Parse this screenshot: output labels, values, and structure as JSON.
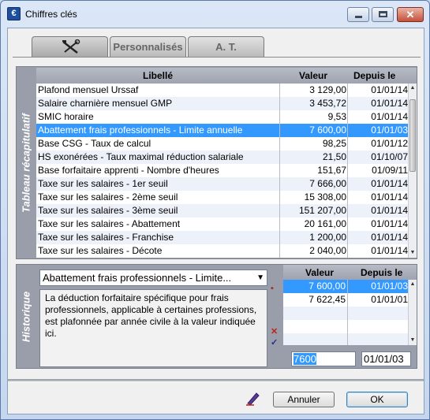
{
  "window": {
    "title": "Chiffres clés",
    "icon_letter": "€",
    "controls": {
      "minimize": "minimize-icon",
      "maximize": "maximize-icon",
      "close": "close-icon"
    }
  },
  "tabs": [
    {
      "label": "",
      "icon": "tools-icon",
      "active": true
    },
    {
      "label": "Personnalisés",
      "active": false
    },
    {
      "label": "A. T.",
      "active": false
    }
  ],
  "summary": {
    "side_label": "Tableau récapitulatif",
    "columns": {
      "label": "Libellé",
      "value": "Valeur",
      "since": "Depuis le"
    },
    "rows": [
      {
        "label": "Plafond mensuel Urssaf",
        "value": "3 129,00",
        "since": "01/01/14"
      },
      {
        "label": "Salaire charnière mensuel GMP",
        "value": "3 453,72",
        "since": "01/01/14"
      },
      {
        "label": "SMIC horaire",
        "value": "9,53",
        "since": "01/01/14"
      },
      {
        "label": "Abattement frais professionnels - Limite annuelle",
        "value": "7 600,00",
        "since": "01/01/03",
        "selected": true
      },
      {
        "label": "Base CSG - Taux de calcul",
        "value": "98,25",
        "since": "01/01/12"
      },
      {
        "label": "HS exonérées - Taux maximal réduction salariale",
        "value": "21,50",
        "since": "01/10/07"
      },
      {
        "label": "Base forfaitaire apprenti - Nombre d'heures",
        "value": "151,67",
        "since": "01/09/11"
      },
      {
        "label": "Taxe sur les salaires - 1er seuil",
        "value": "7 666,00",
        "since": "01/01/14"
      },
      {
        "label": "Taxe sur les salaires - 2ème seuil",
        "value": "15 308,00",
        "since": "01/01/14"
      },
      {
        "label": "Taxe sur les salaires - 3ème seuil",
        "value": "151 207,00",
        "since": "01/01/14"
      },
      {
        "label": "Taxe sur les salaires - Abattement",
        "value": "20 161,00",
        "since": "01/01/14"
      },
      {
        "label": "Taxe sur les salaires - Franchise",
        "value": "1 200,00",
        "since": "01/01/14"
      },
      {
        "label": "Taxe sur les salaires - Décote",
        "value": "2 040,00",
        "since": "01/01/14"
      }
    ]
  },
  "history": {
    "side_label": "Historique",
    "selected_item": "Abattement frais professionnels - Limite...",
    "description": "La déduction forfaitaire spécifique pour frais professionnels, applicable à certaines professions, est plafonnée par année civile à la valeur indiquée ici.",
    "columns": {
      "value": "Valeur",
      "since": "Depuis le"
    },
    "rows": [
      {
        "value": "7 600,00",
        "since": "01/01/03",
        "selected": true
      },
      {
        "value": "7 622,45",
        "since": "01/01/01"
      }
    ],
    "edit_value": "7600",
    "edit_date": "01/01/03",
    "action_icons": [
      "add-icon",
      "delete-icon",
      "validate-icon"
    ]
  },
  "footer": {
    "cancel_label": "Annuler",
    "ok_label": "OK",
    "edit_icon": "pen-icon"
  },
  "colors": {
    "selection": "#3399ff",
    "panel": "#9a9eaa",
    "header": "#a8adb9"
  }
}
